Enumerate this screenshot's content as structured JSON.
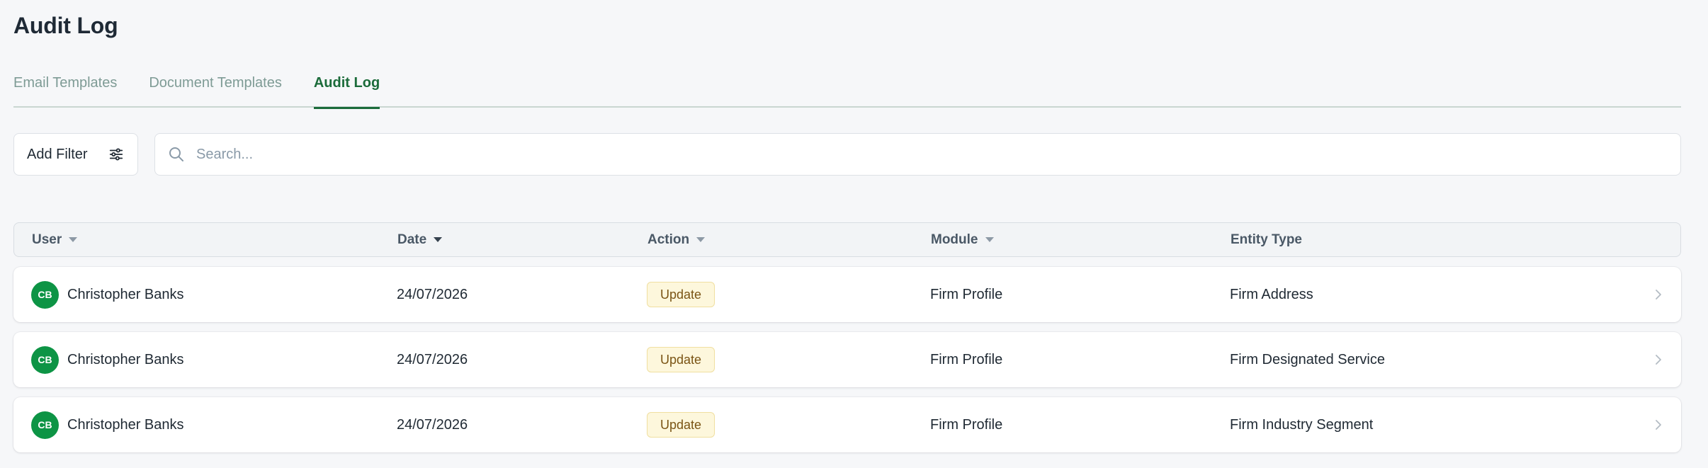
{
  "page": {
    "title": "Audit Log"
  },
  "tabs": [
    {
      "label": "Email Templates",
      "active": false
    },
    {
      "label": "Document Templates",
      "active": false
    },
    {
      "label": "Audit Log",
      "active": true
    }
  ],
  "toolbar": {
    "filter_label": "Add Filter",
    "search_placeholder": "Search...",
    "search_value": ""
  },
  "table": {
    "columns": [
      {
        "label": "User",
        "sortable": true
      },
      {
        "label": "Date",
        "sortable": true
      },
      {
        "label": "Action",
        "sortable": true
      },
      {
        "label": "Module",
        "sortable": true
      },
      {
        "label": "Entity Type",
        "sortable": false
      }
    ],
    "rows": [
      {
        "initials": "CB",
        "user": "Christopher Banks",
        "date": "24/07/2026",
        "action": "Update",
        "module": "Firm Profile",
        "entity_type": "Firm Address"
      },
      {
        "initials": "CB",
        "user": "Christopher Banks",
        "date": "24/07/2026",
        "action": "Update",
        "module": "Firm Profile",
        "entity_type": "Firm Designated Service"
      },
      {
        "initials": "CB",
        "user": "Christopher Banks",
        "date": "24/07/2026",
        "action": "Update",
        "module": "Firm Profile",
        "entity_type": "Firm Industry Segment"
      }
    ]
  },
  "icons": {
    "filter": "sliders-icon",
    "search": "search-icon",
    "row_open": "chevron-right-icon"
  },
  "colors": {
    "accent": "#1b6b3a",
    "avatar": "#0d9445",
    "badge_bg": "#fdf7dc",
    "badge_text": "#7a5414"
  }
}
